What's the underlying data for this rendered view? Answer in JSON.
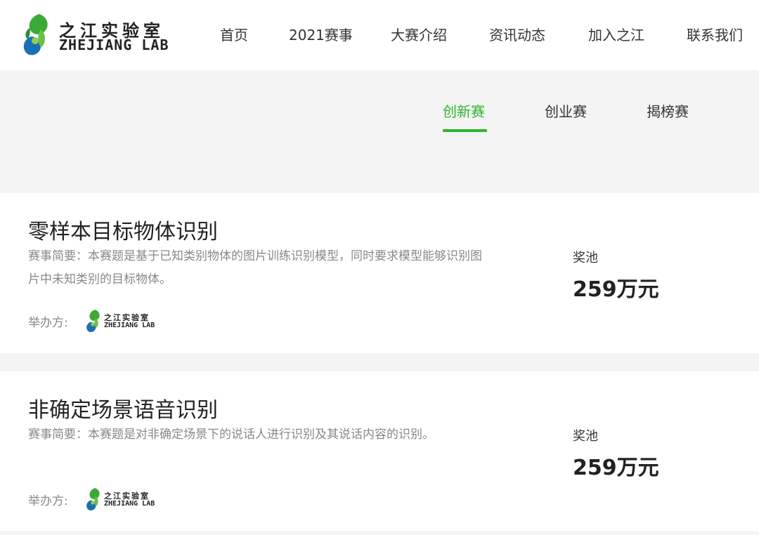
{
  "brand": {
    "cn": "之江实验室",
    "en": "ZHEJIANG LAB"
  },
  "nav": {
    "items": [
      "首页",
      "2021赛事",
      "大赛介绍",
      "资讯动态",
      "加入之江",
      "联系我们"
    ]
  },
  "tabs": {
    "items": [
      "创新赛",
      "创业赛",
      "揭榜赛"
    ],
    "active": "创新赛"
  },
  "colors": {
    "accent": "#2db52d",
    "logo_green": "#3ba935",
    "logo_blue": "#1b6fb5"
  },
  "competitions": [
    {
      "title": "零样本目标物体识别",
      "desc": "赛事简要：本赛题是基于已知类别物体的图片训练识别模型，同时要求模型能够识别图片中未知类别的目标物体。",
      "organizer_label": "举办方:",
      "prize_label": "奖池",
      "prize_value": "259万元"
    },
    {
      "title": "非确定场景语音识别",
      "desc": "赛事简要：本赛题是对非确定场景下的说话人进行识别及其说话内容的识别。",
      "organizer_label": "举办方:",
      "prize_label": "奖池",
      "prize_value": "259万元"
    }
  ]
}
